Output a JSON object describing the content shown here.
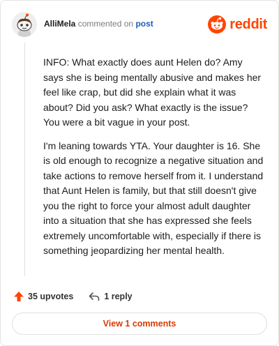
{
  "comment": {
    "username": "AlliMela",
    "action_text": "commented on",
    "post_link": "post",
    "brand_name": "reddit",
    "paragraphs": [
      "INFO: What exactly does aunt Helen do? Amy says she is being mentally abusive and makes her feel like crap, but did she explain what it was about? Did you ask? What exactly is the issue? You were a bit vague in your post.",
      "I'm leaning towards YTA. Your daughter is 16. She is old enough to recognize a negative situation and take actions to remove herself from it. I understand that Aunt Helen is family, but that still doesn't give you the right to force your almost adult daughter into a situation that she has expressed she feels extremely uncomfortable with, especially if there is something jeopardizing her mental health."
    ],
    "upvotes_label": "35 upvotes",
    "reply_label": "1 reply",
    "view_comments_label": "View 1 comments"
  },
  "icons": {
    "avatar": "snoo-avatar",
    "brand": "reddit-logo",
    "upvote": "upvote-arrow-icon",
    "reply": "reply-arrow-icon"
  },
  "colors": {
    "brand": "#ff4500",
    "upvote": "#ff4500",
    "link": "#1a5fb4",
    "view_button_text": "#d93a00"
  }
}
